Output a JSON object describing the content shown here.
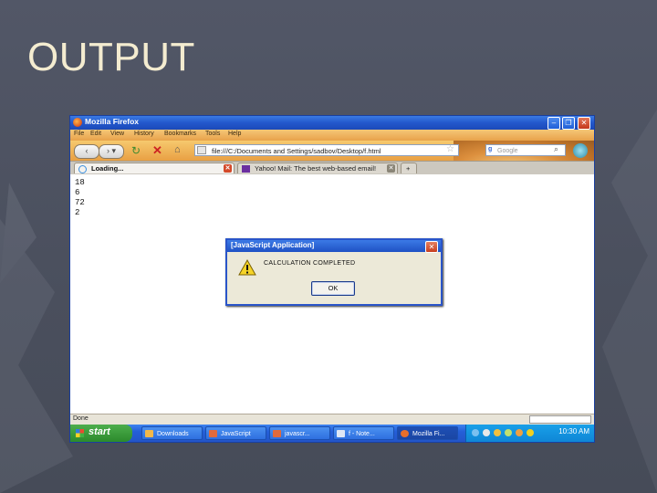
{
  "slide": {
    "title": "OUTPUT"
  },
  "browser": {
    "window_title": "Mozilla Firefox",
    "menu": [
      "File",
      "Edit",
      "View",
      "History",
      "Bookmarks",
      "Tools",
      "Help"
    ],
    "url": "file:///C:/Documents and Settings/sadbov/Desktop/f.html",
    "search_placeholder": "Google",
    "tabs": [
      {
        "label": "Loading...",
        "active": true
      },
      {
        "label": "Yahoo! Mail: The best web-based email!",
        "active": false
      }
    ],
    "new_tab": "+",
    "status": "Done"
  },
  "page": {
    "output_lines": [
      "18",
      "6",
      "72",
      "2"
    ]
  },
  "dialog": {
    "title": "[JavaScript Application]",
    "message": "CALCULATION COMPLETED",
    "ok_label": "OK",
    "close_glyph": "✕"
  },
  "taskbar": {
    "start_label": "start",
    "items": [
      {
        "label": "Downloads",
        "color": "#f2b84a"
      },
      {
        "label": "JavaScript",
        "color": "#e06a3c"
      },
      {
        "label": "javascr...",
        "color": "#e06a3c"
      },
      {
        "label": "f - Note...",
        "color": "#dfe8f5"
      },
      {
        "label": "Mozilla Fi...",
        "color": "#e86f2a",
        "active": true
      }
    ],
    "clock": "10:30 AM"
  },
  "colors": {
    "slide_bg": "#4b505e",
    "title_text": "#f4ecd0",
    "xp_blue": "#245fd8",
    "dialog_bg": "#ece9d8"
  }
}
